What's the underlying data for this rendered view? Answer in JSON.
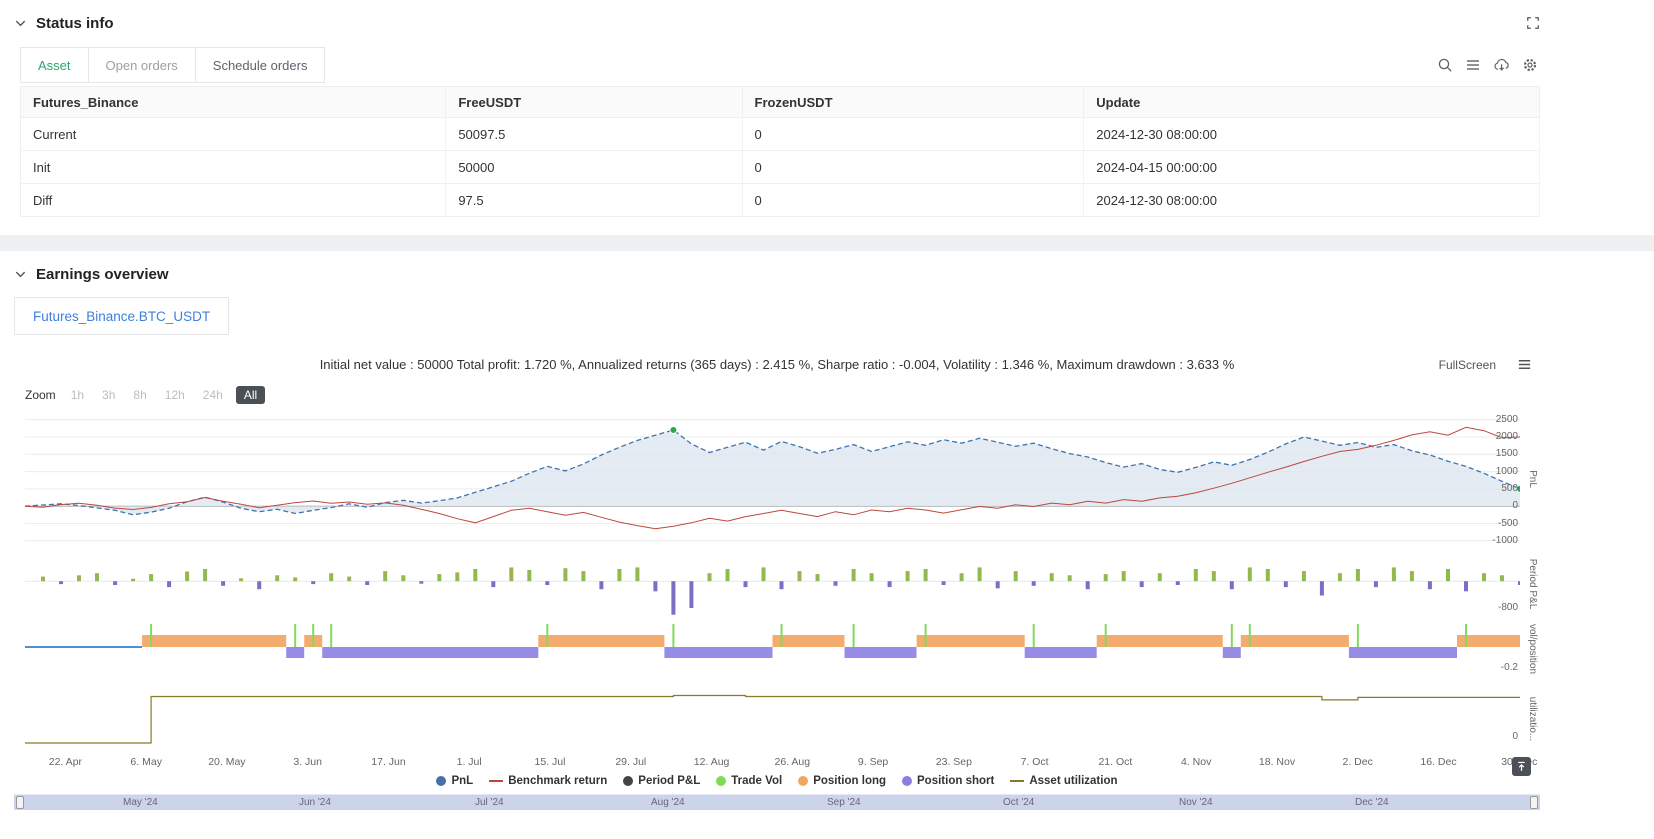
{
  "colors": {
    "accent_green": "#2ba471",
    "link_blue": "#41a6dd",
    "danger_red": "#e25555",
    "tab_blue": "#3d7fe0",
    "pnl_line": "#3f74ad",
    "pnl_fill": "#dde6f0",
    "benchmark": "#bc4740",
    "bar_up": "#94b84f",
    "bar_down": "#7a6fc2",
    "position_long": "#f3ab6e",
    "position_short": "#968ce6",
    "trade_vol": "#83d95f",
    "utilization": "#867b2a",
    "marker_green": "#2aa84a",
    "navigator_fill": "#ccd4ec"
  },
  "status_info": {
    "title": "Status info",
    "tabs": [
      {
        "label": "Asset",
        "active": true,
        "text_color": "#2ba471"
      },
      {
        "label": "Open orders",
        "active": false,
        "text_color": "#9aa1a7"
      },
      {
        "label": "Schedule orders",
        "active": false,
        "text_color": "#5c646b"
      }
    ],
    "table": {
      "headers": [
        "Futures_Binance",
        "FreeUSDT",
        "FrozenUSDT",
        "Update"
      ],
      "rows": [
        {
          "cells": [
            "Current",
            "50097.5",
            "0",
            "2024-12-30 08:00:00"
          ],
          "cell_styles": [
            "link",
            "",
            "",
            ""
          ]
        },
        {
          "cells": [
            "Init",
            "50000",
            "0",
            "2024-04-15 00:00:00"
          ],
          "cell_styles": [
            "",
            "",
            "",
            ""
          ]
        },
        {
          "cells": [
            "Diff",
            "97.5",
            "0",
            "2024-12-30 08:00:00"
          ],
          "cell_styles": [
            "danger",
            "danger",
            "",
            ""
          ]
        }
      ]
    }
  },
  "earnings": {
    "title": "Earnings overview",
    "tab": "Futures_Binance.BTC_USDT",
    "stats": "Initial net value : 50000 Total profit: 1.720 %, Annualized returns (365 days) : 2.415 %, Sharpe ratio : -0.004, Volatility : 1.346 %, Maximum drawdown : 3.633 %",
    "fullscreen_label": "FullScreen",
    "zoom": {
      "label": "Zoom",
      "buttons": [
        "1h",
        "3h",
        "8h",
        "12h",
        "24h",
        "All"
      ],
      "selected": "All"
    }
  },
  "chart_data": {
    "type": "mixed",
    "x_range": [
      "2024-04-15",
      "2024-12-30"
    ],
    "x_labels": [
      "22. Apr",
      "6. May",
      "20. May",
      "3. Jun",
      "17. Jun",
      "1. Jul",
      "15. Jul",
      "29. Jul",
      "12. Aug",
      "26. Aug",
      "9. Sep",
      "23. Sep",
      "7. Oct",
      "21. Oct",
      "4. Nov",
      "18. Nov",
      "2. Dec",
      "16. Dec",
      "30. Dec"
    ],
    "panels": [
      {
        "id": "pnl",
        "ylabel": "PnL",
        "yticks": [
          2500,
          2000,
          1500,
          1000,
          500,
          0,
          -500,
          -1000
        ],
        "ymin": -1150,
        "ymax": 2750,
        "series": [
          {
            "name": "PnL",
            "type": "area-dashed",
            "color": "#3f74ad",
            "fill": "#dde6f0",
            "values": [
              0,
              35,
              70,
              20,
              -50,
              -120,
              -250,
              -170,
              -60,
              130,
              260,
              120,
              -60,
              -160,
              -90,
              -210,
              -120,
              -40,
              70,
              -30,
              100,
              170,
              90,
              160,
              240,
              400,
              560,
              720,
              950,
              1150,
              1020,
              1220,
              1480,
              1700,
              1900,
              2050,
              2200,
              1800,
              1550,
              1700,
              1850,
              1620,
              1870,
              1720,
              1530,
              1640,
              1780,
              1580,
              1720,
              1860,
              1760,
              1920,
              1820,
              1960,
              1850,
              1730,
              1820,
              1660,
              1520,
              1420,
              1260,
              1130,
              1230,
              1060,
              980,
              1120,
              1280,
              1180,
              1350,
              1560,
              1800,
              2000,
              1880,
              1760,
              1840,
              1700,
              1780,
              1600,
              1480,
              1300,
              1150,
              950,
              720,
              500
            ]
          },
          {
            "name": "Benchmark return",
            "type": "line",
            "color": "#bc4740",
            "values": [
              0,
              -30,
              45,
              85,
              25,
              -55,
              -95,
              -35,
              70,
              130,
              250,
              140,
              55,
              -45,
              25,
              105,
              150,
              85,
              120,
              55,
              95,
              30,
              -90,
              -210,
              -360,
              -480,
              -300,
              -120,
              -60,
              -160,
              -260,
              -180,
              -320,
              -460,
              -560,
              -650,
              -580,
              -480,
              -350,
              -430,
              -300,
              -210,
              -120,
              -210,
              -300,
              -160,
              -250,
              -110,
              -160,
              -60,
              -110,
              -200,
              -100,
              -10,
              -60,
              40,
              -10,
              90,
              40,
              140,
              90,
              190,
              140,
              240,
              290,
              390,
              520,
              660,
              820,
              980,
              1130,
              1290,
              1440,
              1580,
              1640,
              1760,
              1900,
              2060,
              2150,
              2050,
              2280,
              2180,
              1980,
              2000
            ]
          }
        ],
        "markers": "max-and-last"
      },
      {
        "id": "period_pnl",
        "ylabel": "Period P&L",
        "yticks": [
          -800
        ],
        "ymin": -830,
        "ymax": 720,
        "series": [
          {
            "name": "Period P&L",
            "type": "bar",
            "pos_color": "#94b84f",
            "neg_color": "#7a6fc2",
            "values": [
              0,
              110,
              -70,
              140,
              190,
              -90,
              60,
              170,
              -140,
              230,
              290,
              -110,
              70,
              -190,
              140,
              90,
              -70,
              190,
              110,
              -90,
              240,
              140,
              -60,
              170,
              210,
              290,
              -140,
              330,
              270,
              -90,
              310,
              240,
              -190,
              290,
              330,
              -240,
              -800,
              -640,
              190,
              290,
              -140,
              330,
              -190,
              240,
              170,
              -110,
              290,
              190,
              -140,
              240,
              290,
              -90,
              190,
              330,
              -170,
              240,
              -110,
              190,
              140,
              -190,
              170,
              240,
              -140,
              190,
              -90,
              290,
              240,
              -190,
              330,
              290,
              -140,
              240,
              -340,
              190,
              290,
              -140,
              330,
              240,
              -190,
              290,
              -240,
              190,
              140,
              -90
            ]
          }
        ]
      },
      {
        "id": "vol_position",
        "ylabel": "vol/position",
        "yticks": [
          -0.2
        ],
        "series": [
          {
            "name": "Position",
            "type": "band",
            "long_color": "#f3ab6e",
            "short_color": "#968ce6",
            "flat_color": "#4a90d9",
            "values": [
              0,
              0,
              0,
              0,
              0,
              0,
              0,
              1,
              1,
              1,
              1,
              1,
              1,
              1,
              1,
              -1,
              1,
              -1,
              -1,
              -1,
              -1,
              -1,
              -1,
              -1,
              -1,
              -1,
              -1,
              -1,
              -1,
              1,
              1,
              1,
              1,
              1,
              1,
              1,
              -1,
              -1,
              -1,
              -1,
              -1,
              -1,
              1,
              1,
              1,
              1,
              -1,
              -1,
              -1,
              -1,
              1,
              1,
              1,
              1,
              1,
              1,
              -1,
              -1,
              -1,
              -1,
              1,
              1,
              1,
              1,
              1,
              1,
              1,
              -1,
              1,
              1,
              1,
              1,
              1,
              1,
              -1,
              -1,
              -1,
              -1,
              -1,
              -1,
              1,
              1,
              1,
              1,
              1
            ]
          },
          {
            "name": "Trade Vol",
            "type": "spike",
            "color": "#83d95f"
          }
        ]
      },
      {
        "id": "utilization",
        "ylabel": "utilizatio...",
        "yticks": [
          0
        ],
        "series": [
          {
            "name": "Asset utilization",
            "type": "step",
            "color": "#867b2a",
            "values": [
              0,
              0,
              0,
              0,
              0,
              0,
              0,
              0.95,
              0.95,
              0.95,
              0.95,
              0.95,
              0.95,
              0.95,
              0.95,
              0.95,
              0.95,
              0.95,
              0.95,
              0.95,
              0.95,
              0.95,
              0.95,
              0.95,
              0.95,
              0.95,
              0.95,
              0.95,
              0.95,
              0.95,
              0.95,
              0.95,
              0.95,
              0.95,
              0.95,
              0.95,
              0.97,
              0.97,
              0.97,
              0.97,
              0.95,
              0.95,
              0.95,
              0.95,
              0.95,
              0.95,
              0.95,
              0.95,
              0.95,
              0.95,
              0.95,
              0.95,
              0.95,
              0.95,
              0.95,
              0.95,
              0.95,
              0.95,
              0.95,
              0.95,
              0.95,
              0.95,
              0.95,
              0.95,
              0.95,
              0.95,
              0.95,
              0.95,
              0.95,
              0.95,
              0.95,
              0.95,
              0.88,
              0.88,
              0.93,
              0.93,
              0.93,
              0.93,
              0.93,
              0.93,
              0.93,
              0.93,
              0.93,
              0.93
            ]
          }
        ]
      }
    ],
    "legend": [
      {
        "label": "PnL",
        "marker": "circle",
        "color": "#4472a8"
      },
      {
        "label": "Benchmark return",
        "marker": "line",
        "color": "#bc4740"
      },
      {
        "label": "Period P&L",
        "marker": "circle",
        "color": "#444444"
      },
      {
        "label": "Trade Vol",
        "marker": "circle",
        "color": "#7ddd57"
      },
      {
        "label": "Position long",
        "marker": "circle",
        "color": "#f0a860"
      },
      {
        "label": "Position short",
        "marker": "circle",
        "color": "#8a7fe0"
      },
      {
        "label": "Asset utilization",
        "marker": "line",
        "color": "#867b2a"
      }
    ]
  },
  "navigator": {
    "months": [
      "May '24",
      "Jun '24",
      "Jul '24",
      "Aug '24",
      "Sep '24",
      "Oct '24",
      "Nov '24",
      "Dec '24"
    ]
  }
}
